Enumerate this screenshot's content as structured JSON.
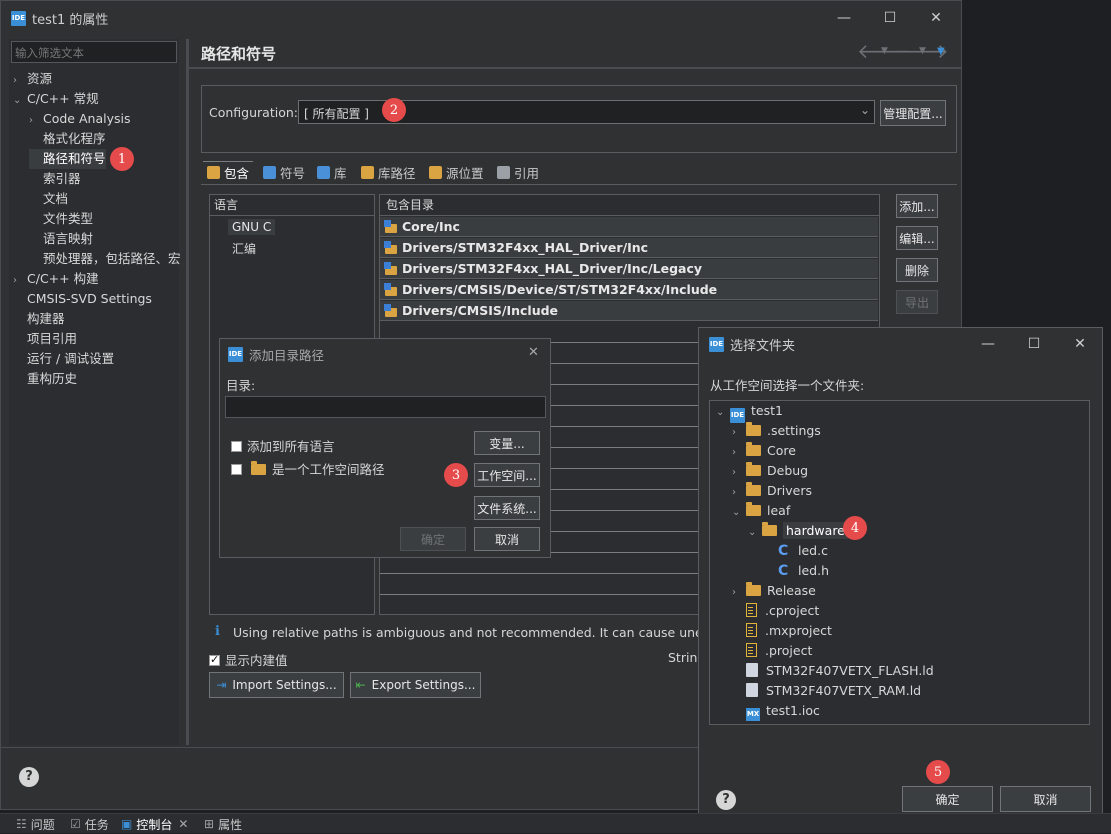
{
  "main_window": {
    "title": "test1 的属性",
    "filter_placeholder": "输入筛选文本",
    "page_title": "路径和符号",
    "nav_tree": [
      {
        "label": "资源",
        "chevron": "›"
      },
      {
        "label": "C/C++ 常规",
        "chevron": "⌄"
      },
      {
        "label": "Code Analysis",
        "chevron": "›"
      },
      {
        "label": "格式化程序",
        "chevron": ""
      },
      {
        "label": "路径和符号",
        "chevron": ""
      },
      {
        "label": "索引器",
        "chevron": ""
      },
      {
        "label": "文档",
        "chevron": ""
      },
      {
        "label": "文件类型",
        "chevron": ""
      },
      {
        "label": "语言映射",
        "chevron": ""
      },
      {
        "label": "预处理器，包括路径、宏",
        "chevron": ""
      },
      {
        "label": "C/C++ 构建",
        "chevron": "›"
      },
      {
        "label": "CMSIS-SVD Settings",
        "chevron": ""
      },
      {
        "label": "构建器",
        "chevron": ""
      },
      {
        "label": "项目引用",
        "chevron": ""
      },
      {
        "label": "运行 / 调试设置",
        "chevron": ""
      },
      {
        "label": "重构历史",
        "chevron": ""
      }
    ],
    "configuration_label": "Configuration:",
    "configuration_value": "[ 所有配置 ]",
    "manage_button": "管理配置...",
    "tabs": [
      {
        "label": "包含",
        "color": "#d9a441"
      },
      {
        "label": "符号",
        "color": "#4a90d9"
      },
      {
        "label": "库",
        "color": "#4a90d9"
      },
      {
        "label": "库路径",
        "color": "#d9a441"
      },
      {
        "label": "源位置",
        "color": "#d9a441"
      },
      {
        "label": "引用",
        "color": "#9aa0a6"
      }
    ],
    "languages_header": "语言",
    "languages": [
      "GNU C",
      "汇编"
    ],
    "include_header": "包含目录",
    "includes": [
      "Core/Inc",
      "Drivers/STM32F4xx_HAL_Driver/Inc",
      "Drivers/STM32F4xx_HAL_Driver/Inc/Legacy",
      "Drivers/CMSIS/Device/ST/STM32F4xx/Include",
      "Drivers/CMSIS/Include"
    ],
    "side_buttons": [
      "添加...",
      "编辑...",
      "删除",
      "导出"
    ],
    "info_text": "Using relative paths is ambiguous and not recommended. It can cause unexpect",
    "show_builtin_label": "显示内建值",
    "strings_label": "String",
    "import_button": "Import Settings...",
    "export_button": "Export Settings..."
  },
  "add_dir_dialog": {
    "title": "添加目录路径",
    "directory_label": "目录:",
    "directory_value": "",
    "add_all_langs": "添加到所有语言",
    "is_workspace_path": "是一个工作空间路径",
    "variables_button": "变量...",
    "workspace_button": "工作空间...",
    "filesystem_button": "文件系统...",
    "ok_button": "确定",
    "cancel_button": "取消"
  },
  "folder_dialog": {
    "title": "选择文件夹",
    "prompt": "从工作空间选择一个文件夹:",
    "tree": [
      {
        "label": "test1",
        "type": "project",
        "indent": 0,
        "chevron": "⌄"
      },
      {
        "label": ".settings",
        "type": "folder",
        "indent": 1,
        "chevron": "›"
      },
      {
        "label": "Core",
        "type": "folder",
        "indent": 1,
        "chevron": "›"
      },
      {
        "label": "Debug",
        "type": "folder",
        "indent": 1,
        "chevron": "›"
      },
      {
        "label": "Drivers",
        "type": "folder",
        "indent": 1,
        "chevron": "›"
      },
      {
        "label": "leaf",
        "type": "folder",
        "indent": 1,
        "chevron": "⌄"
      },
      {
        "label": "hardware",
        "type": "folder",
        "indent": 2,
        "chevron": "⌄"
      },
      {
        "label": "led.c",
        "type": "c",
        "indent": 3,
        "chevron": ""
      },
      {
        "label": "led.h",
        "type": "c",
        "indent": 3,
        "chevron": ""
      },
      {
        "label": "Release",
        "type": "folder",
        "indent": 1,
        "chevron": "›"
      },
      {
        "label": ".cproject",
        "type": "file",
        "indent": 1,
        "chevron": ""
      },
      {
        "label": ".mxproject",
        "type": "file",
        "indent": 1,
        "chevron": ""
      },
      {
        "label": ".project",
        "type": "file",
        "indent": 1,
        "chevron": ""
      },
      {
        "label": "STM32F407VETX_FLASH.ld",
        "type": "ld",
        "indent": 1,
        "chevron": ""
      },
      {
        "label": "STM32F407VETX_RAM.ld",
        "type": "ld",
        "indent": 1,
        "chevron": ""
      },
      {
        "label": "test1.ioc",
        "type": "mx",
        "indent": 1,
        "chevron": ""
      }
    ],
    "ok_button": "确定",
    "cancel_button": "取消"
  },
  "badges": [
    "1",
    "2",
    "3",
    "4",
    "5"
  ],
  "bottom_tabs": [
    "问题",
    "任务",
    "控制台",
    "属性"
  ],
  "colors": {
    "badge": "#e54b4b",
    "accent": "#3b8fd6",
    "folder": "#d9a441"
  }
}
